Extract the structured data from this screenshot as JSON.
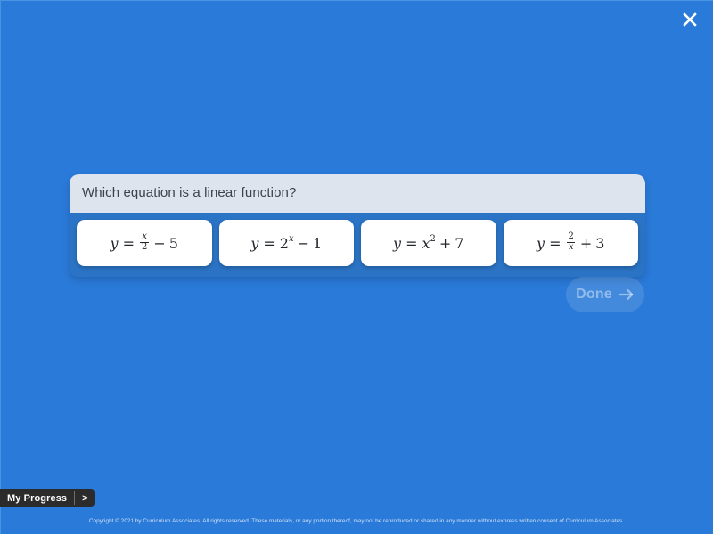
{
  "window": {
    "background_color": "#2a7ad9",
    "close_label": "✕"
  },
  "question": {
    "prompt": "Which equation is a linear function?",
    "header_color": "#dee4ed",
    "panel_color": "#2b73c4"
  },
  "choices": [
    {
      "id": "choice-a",
      "equation": "y = x/2 - 5",
      "lhs": "y",
      "eq": "=",
      "numerator": "x",
      "denominator": "2",
      "operator": "−",
      "constant": "5",
      "form": "fraction"
    },
    {
      "id": "choice-b",
      "equation": "y = 2^x - 1",
      "lhs": "y",
      "eq": "=",
      "base": "2",
      "exponent": "x",
      "operator": "−",
      "constant": "1",
      "form": "exponent"
    },
    {
      "id": "choice-c",
      "equation": "y = x^2 + 7",
      "lhs": "y",
      "eq": "=",
      "base": "x",
      "exponent": "2",
      "operator": "+",
      "constant": "7",
      "form": "power"
    },
    {
      "id": "choice-d",
      "equation": "y = 2/x + 3",
      "lhs": "y",
      "eq": "=",
      "numerator": "2",
      "denominator": "x",
      "operator": "+",
      "constant": "3",
      "form": "fraction"
    }
  ],
  "done_button": {
    "label": "Done",
    "enabled": false,
    "icon": "arrow-right-icon"
  },
  "progress": {
    "label": "My Progress",
    "chevron": ">"
  },
  "footer": {
    "copyright": "Copyright © 2021 by Curriculum Associates. All rights reserved. These materials, or any portion thereof, may not be reproduced or shared in any manner without express written consent of Curriculum Associates."
  }
}
